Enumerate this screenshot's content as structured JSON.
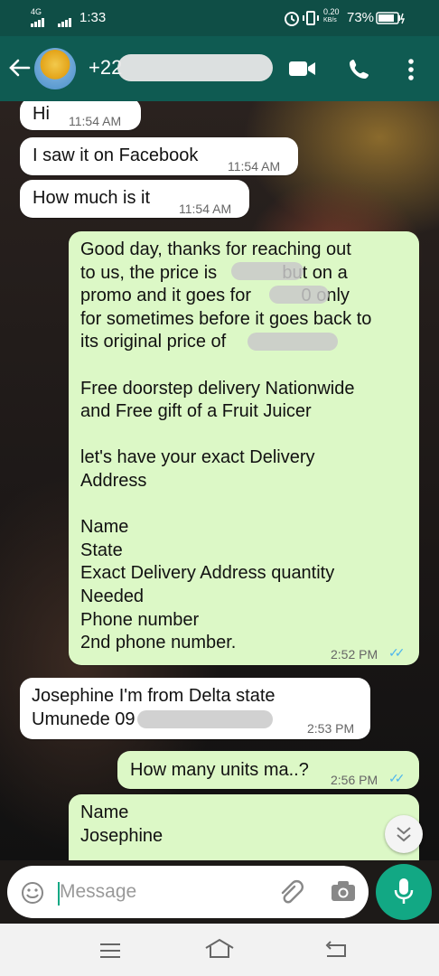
{
  "status_bar": {
    "network": "4G",
    "time": "1:33",
    "speed_value": "0.20",
    "speed_unit": "KB/s",
    "battery": "73%"
  },
  "header": {
    "contact": "+22"
  },
  "messages": [
    {
      "dir": "in",
      "text": "Hi",
      "time": "11:54 AM"
    },
    {
      "dir": "in",
      "text": "I saw it on Facebook",
      "time": "11:54 AM"
    },
    {
      "dir": "in",
      "text": "How much is it",
      "time": "11:54 AM"
    },
    {
      "dir": "out",
      "text": "Good day, thanks for reaching out\nto us, the price is             but on a\npromo and it goes for          0 only\nfor sometimes before it goes back to\nits original price of \n\nFree doorstep delivery Nationwide\nand Free gift of a Fruit Juicer\n\nlet's have your exact Delivery\nAddress\n\nName\nState\nExact Delivery Address quantity\nNeeded\nPhone number\n2nd phone number.",
      "time": "2:52 PM"
    },
    {
      "dir": "in",
      "text": "Josephine I'm from Delta state\nUmunede 09",
      "time": "2:53 PM"
    },
    {
      "dir": "out",
      "text": "How many units ma..?",
      "time": "2:56 PM"
    },
    {
      "dir": "out",
      "text": "Name\nJosephine",
      "time": ""
    }
  ],
  "input": {
    "placeholder": "Message"
  },
  "colors": {
    "header": "#0f5b52",
    "outgoing_bubble": "#dcf8c6",
    "incoming_bubble": "#ffffff",
    "mic_button": "#12a884",
    "read_ticks": "#4fb6ec"
  },
  "icons": [
    "back-arrow-icon",
    "avatar",
    "video-call-icon",
    "phone-icon",
    "more-vert-icon",
    "emoji-icon",
    "attach-icon",
    "camera-icon",
    "mic-icon",
    "scroll-down-icon",
    "nav-menu-icon",
    "nav-home-icon",
    "nav-back-icon"
  ]
}
